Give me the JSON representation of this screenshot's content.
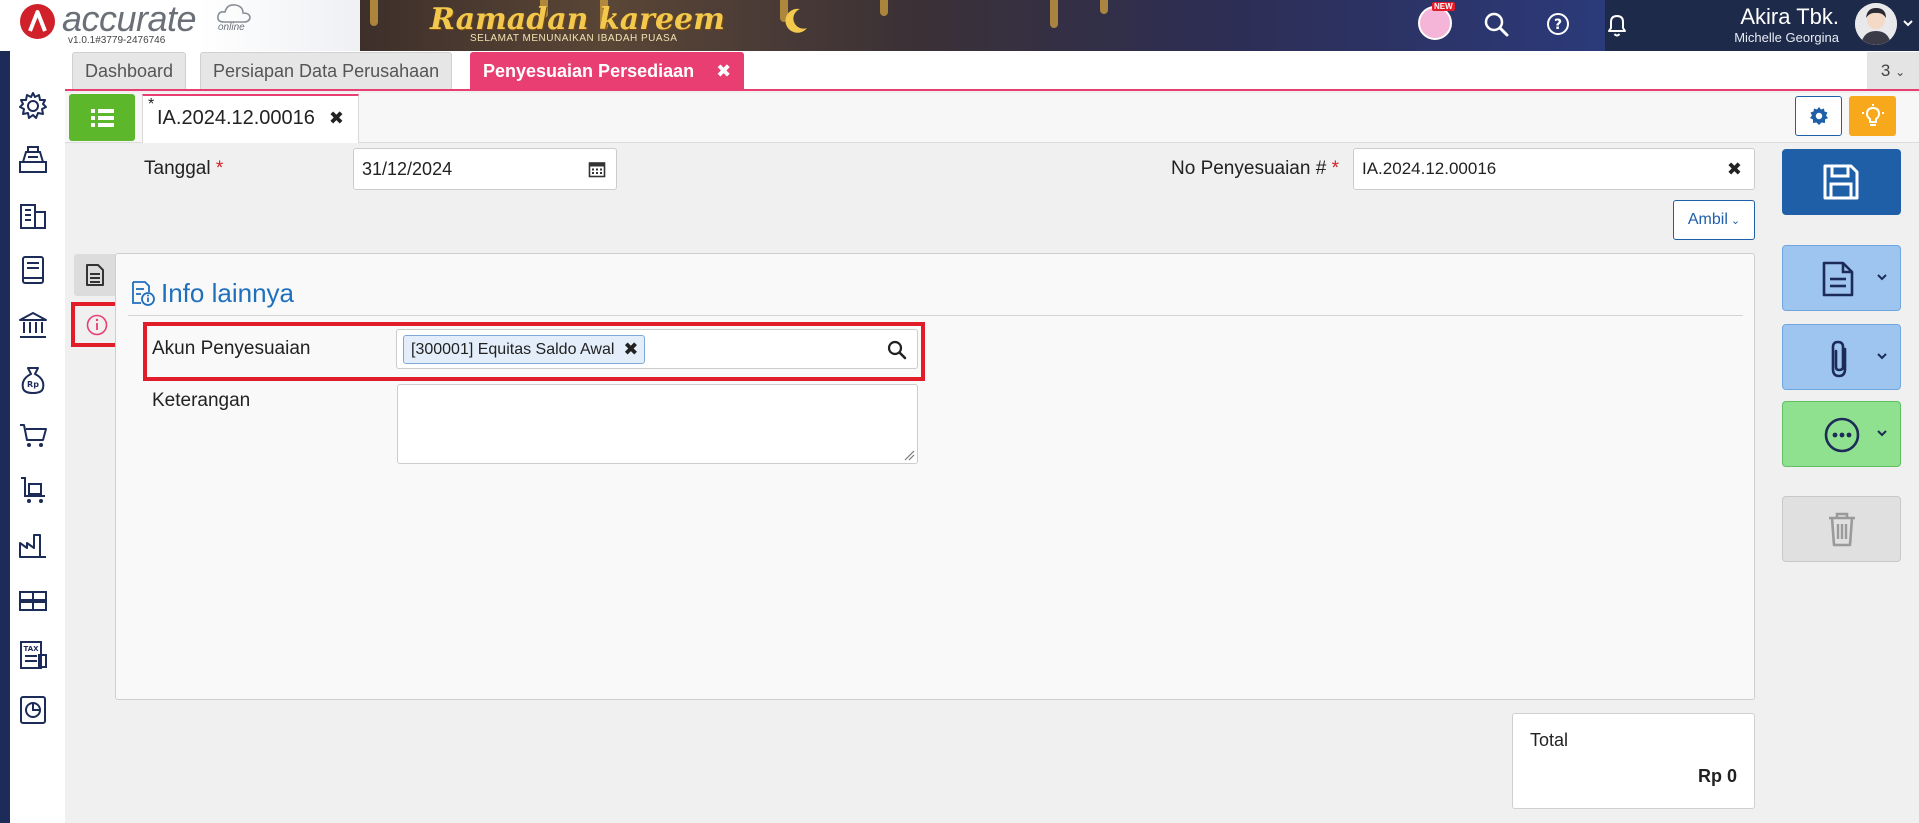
{
  "app": {
    "logo_text": "accurate",
    "logo_online": "online",
    "version": "v1.0.1#3779-2476746",
    "banner_title": "Ramadan kareem",
    "banner_subtitle": "SELAMAT MENUNAIKAN IBADAH PUASA",
    "new_badge": "NEW",
    "user_name": "Akira Tbk.",
    "user_company": "Michelle Georgina"
  },
  "tabs": [
    {
      "label": "Dashboard"
    },
    {
      "label": "Persiapan Data Perusahaan"
    },
    {
      "label": "Penyesuaian Persediaan",
      "active": true,
      "close": "✖"
    }
  ],
  "tab_count": "3",
  "doc_tab": {
    "star": "*",
    "label": "IA.2024.12.00016",
    "close": "✖"
  },
  "form": {
    "tanggal_label": "Tanggal",
    "required_mark": "*",
    "tanggal_value": "31/12/2024",
    "no_label": "No Penyesuaian #",
    "no_value": "IA.2024.12.00016",
    "no_clear": "✖",
    "ambil_label": "Ambil"
  },
  "panel": {
    "title": "Info lainnya",
    "akun_label": "Akun Penyesuaian",
    "akun_value": "[300001] Equitas Saldo Awal",
    "akun_remove": "✖",
    "keterangan_label": "Keterangan",
    "keterangan_value": ""
  },
  "total": {
    "label": "Total",
    "value": "Rp 0"
  },
  "colors": {
    "accent_pink": "#e83e72",
    "primary_blue": "#1f5fa8",
    "sidebar_navy": "#1c2b57",
    "green": "#5cb82a",
    "highlight_red": "#e11d2a"
  },
  "sidebar_icons": [
    "gear-icon",
    "cashier-icon",
    "building-icon",
    "ledger-icon",
    "bank-icon",
    "money-bag-icon",
    "cart-icon",
    "purchase-cart-icon",
    "factory-icon",
    "warehouse-icon",
    "tax-icon",
    "report-icon"
  ]
}
